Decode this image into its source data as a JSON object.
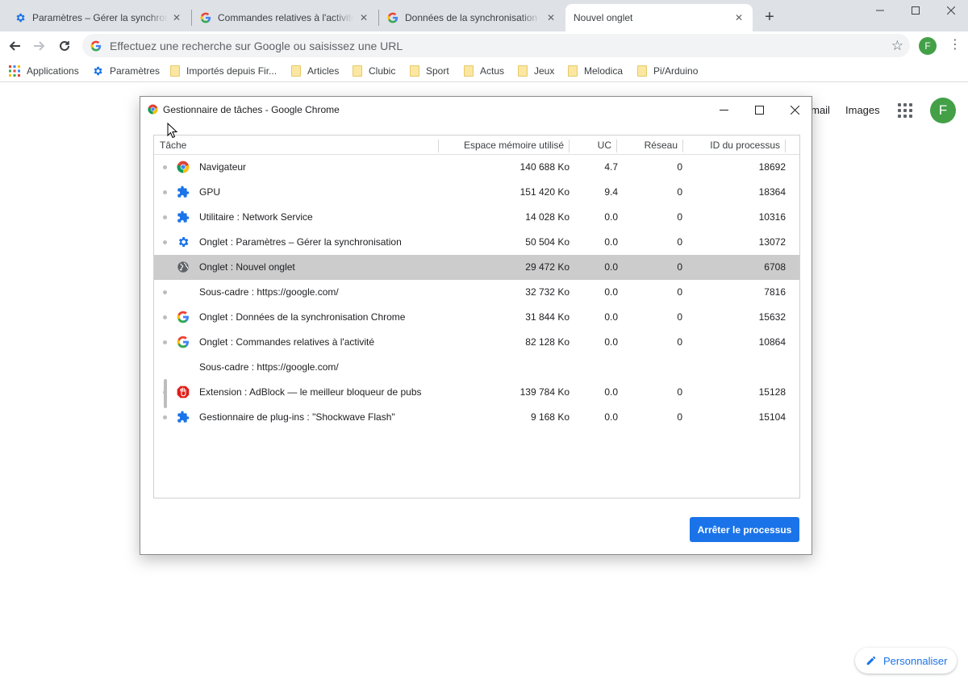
{
  "tabs": [
    {
      "title": "Paramètres – Gérer la synchronisation",
      "icon": "gear-icon"
    },
    {
      "title": "Commandes relatives à l'activité",
      "icon": "google-g-icon"
    },
    {
      "title": "Données de la synchronisation Chrome",
      "icon": "google-g-icon"
    },
    {
      "title": "Nouvel onglet",
      "icon": "none",
      "active": true
    }
  ],
  "omnibox": {
    "placeholder": "Effectuez une recherche sur Google ou saisissez une URL"
  },
  "profile": {
    "initial": "F"
  },
  "bookmarks": [
    {
      "label": "Applications",
      "icon": "apps-grid-icon"
    },
    {
      "label": "Paramètres",
      "icon": "gear-icon"
    },
    {
      "label": "Importés depuis Fir...",
      "icon": "folder-icon"
    },
    {
      "label": "Articles",
      "icon": "folder-icon"
    },
    {
      "label": "Clubic",
      "icon": "folder-icon"
    },
    {
      "label": "Sport",
      "icon": "folder-icon"
    },
    {
      "label": "Actus",
      "icon": "folder-icon"
    },
    {
      "label": "Jeux",
      "icon": "folder-icon"
    },
    {
      "label": "Melodica",
      "icon": "folder-icon"
    },
    {
      "label": "Pi/Arduino",
      "icon": "folder-icon"
    }
  ],
  "page": {
    "gmail": "Gmail",
    "images": "Images",
    "customize": "Personnaliser",
    "customize_icon": "pencil-icon"
  },
  "task_manager": {
    "title": "Gestionnaire de tâches - Google Chrome",
    "columns": {
      "task": "Tâche",
      "memory": "Espace mémoire utilisé",
      "cpu": "UC",
      "network": "Réseau",
      "pid": "ID du processus"
    },
    "rows": [
      {
        "name": "Navigateur",
        "icon": "chrome-icon",
        "memory": "140 688 Ko",
        "cpu": "4.7",
        "network": "0",
        "pid": "18692"
      },
      {
        "name": "GPU",
        "icon": "puzzle-icon",
        "memory": "151 420 Ko",
        "cpu": "9.4",
        "network": "0",
        "pid": "18364"
      },
      {
        "name": "Utilitaire : Network Service",
        "icon": "puzzle-icon",
        "memory": "14 028 Ko",
        "cpu": "0.0",
        "network": "0",
        "pid": "10316"
      },
      {
        "name": "Onglet : Paramètres – Gérer la synchronisation",
        "icon": "gear-icon",
        "memory": "50 504 Ko",
        "cpu": "0.0",
        "network": "0",
        "pid": "13072"
      },
      {
        "name": "Onglet : Nouvel onglet",
        "icon": "globe-icon",
        "memory": "29 472 Ko",
        "cpu": "0.0",
        "network": "0",
        "pid": "6708",
        "selected": true
      },
      {
        "name": "Sous-cadre : https://google.com/",
        "icon": "none",
        "memory": "32 732 Ko",
        "cpu": "0.0",
        "network": "0",
        "pid": "7816"
      },
      {
        "name": "Onglet : Données de la synchronisation Chrome",
        "icon": "google-g-icon",
        "memory": "31 844 Ko",
        "cpu": "0.0",
        "network": "0",
        "pid": "15632"
      },
      {
        "name": "Onglet : Commandes relatives à l'activité",
        "icon": "google-g-icon",
        "memory": "82 128 Ko",
        "cpu": "0.0",
        "network": "0",
        "pid": "10864"
      },
      {
        "name": "Sous-cadre : https://google.com/",
        "icon": "none",
        "memory": "",
        "cpu": "",
        "network": "",
        "pid": ""
      },
      {
        "name": "Extension : AdBlock — le meilleur bloqueur de pubs",
        "icon": "adblock-icon",
        "memory": "139 784 Ko",
        "cpu": "0.0",
        "network": "0",
        "pid": "15128"
      },
      {
        "name": "Gestionnaire de plug-ins : \"Shockwave Flash\"",
        "icon": "puzzle-icon",
        "memory": "9 168 Ko",
        "cpu": "0.0",
        "network": "0",
        "pid": "15104"
      }
    ],
    "end_process_label": "Arrêter le processus"
  },
  "colors": {
    "accent": "#1a73e8",
    "avatar": "#43a047",
    "tabstrip": "#dee1e6",
    "selected_row": "#cccccc"
  }
}
